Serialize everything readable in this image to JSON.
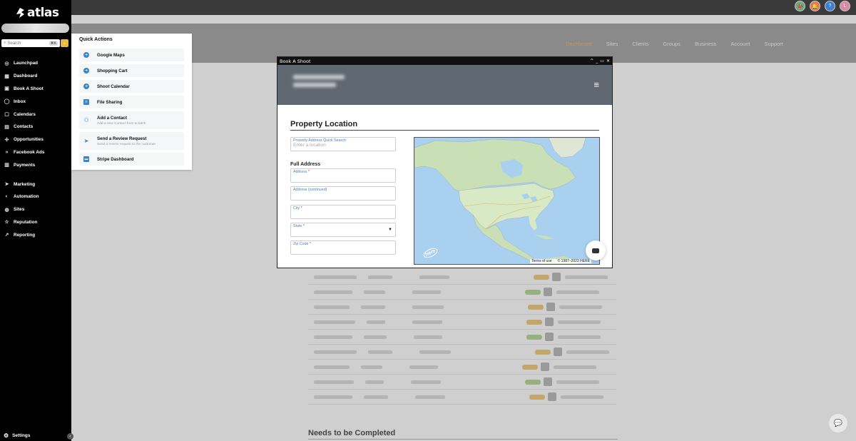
{
  "app": {
    "logo_text": "atlas",
    "search_placeholder": "Search",
    "search_shortcut": "⌘K"
  },
  "sidebar": {
    "items": [
      {
        "label": "Launchpad",
        "icon": "launchpad-icon"
      },
      {
        "label": "Dashboard",
        "icon": "dashboard-icon"
      },
      {
        "label": "Book A Shoot",
        "icon": "calendar-icon"
      },
      {
        "label": "Inbox",
        "icon": "chat-icon"
      },
      {
        "label": "Calendars",
        "icon": "calendar-icon"
      },
      {
        "label": "Contacts",
        "icon": "contacts-icon"
      },
      {
        "label": "Opportunities",
        "icon": "opportunities-icon"
      },
      {
        "label": "Facebook Ads",
        "icon": "chevrons-icon"
      },
      {
        "label": "Payments",
        "icon": "payments-icon"
      },
      {
        "label": "Marketing",
        "icon": "send-icon"
      },
      {
        "label": "Automation",
        "icon": "automation-icon"
      },
      {
        "label": "Sites",
        "icon": "sites-icon"
      },
      {
        "label": "Reputation",
        "icon": "star-icon"
      },
      {
        "label": "Reporting",
        "icon": "trend-icon"
      }
    ],
    "settings_label": "Settings"
  },
  "quick_actions": {
    "title": "Quick Actions",
    "items": [
      {
        "label": "Google Maps",
        "sub": ""
      },
      {
        "label": "Shopping Cart",
        "sub": ""
      },
      {
        "label": "Shoot Calendar",
        "sub": ""
      },
      {
        "label": "File Sharing",
        "sub": ""
      },
      {
        "label": "Add a Contact",
        "sub": "Add a new Contact from scratch"
      },
      {
        "label": "Send a Review Request",
        "sub": "Send a review request to the customer"
      },
      {
        "label": "Stripe Dashboard",
        "sub": ""
      }
    ]
  },
  "site_nav": {
    "items": [
      "Dashboard",
      "Sites",
      "Clients",
      "Groups",
      "Business",
      "Account",
      "Support"
    ]
  },
  "modal": {
    "window_title": "Book A Shoot",
    "section_title": "Property Location",
    "quick_search": {
      "label": "Property Address Quick Search",
      "placeholder": "Enter a location"
    },
    "full_address_title": "Full Address",
    "fields": [
      {
        "label": "Address",
        "required": true
      },
      {
        "label": "Address (continued)",
        "required": false
      },
      {
        "label": "City",
        "required": true
      },
      {
        "label": "State",
        "required": true,
        "select": true
      },
      {
        "label": "Zip Code",
        "required": true
      }
    ],
    "map": {
      "terms": "Terms of use",
      "copyright": "© 1987–2023 HERE",
      "logo": "here"
    }
  },
  "background": {
    "needs_title": "Needs to be Completed"
  },
  "colors": {
    "sidebar_bg": "#000000",
    "accent_blue": "#3a86c8",
    "active_nav": "#c89560",
    "map_water": "#a9d1ef"
  }
}
